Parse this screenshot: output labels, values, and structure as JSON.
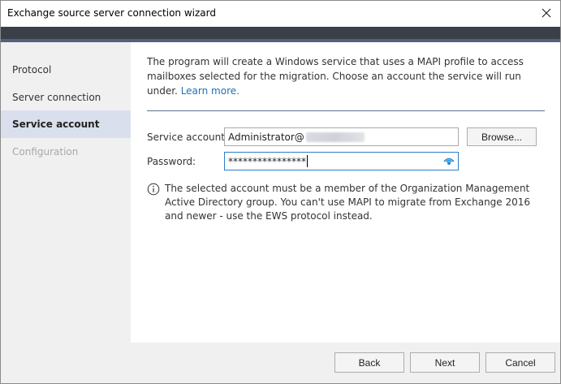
{
  "window": {
    "title": "Exchange source server connection wizard"
  },
  "sidebar": {
    "items": [
      {
        "label": "Protocol",
        "state": "normal"
      },
      {
        "label": "Server connection",
        "state": "normal"
      },
      {
        "label": "Service account",
        "state": "active"
      },
      {
        "label": "Configuration",
        "state": "disabled"
      }
    ]
  },
  "main": {
    "description": "The program will create a Windows service that uses a MAPI profile to access mailboxes selected for the migration. Choose an account the service will run under.",
    "learn_more": "Learn more.",
    "service_account": {
      "label": "Service account:",
      "value": "Administrator@"
    },
    "password": {
      "label": "Password:",
      "value": "****************"
    },
    "browse_label": "Browse...",
    "info_text": "The selected account must be a member of the Organization Management Active Directory group. You can't use MAPI to migrate from Exchange 2016 and newer - use the EWS protocol instead."
  },
  "footer": {
    "back_label": "Back",
    "next_label": "Next",
    "cancel_label": "Cancel"
  },
  "colors": {
    "title_dark_bar": "#3b3f47",
    "accent_bar": "#53617e",
    "active_nav_bg": "#d9dfec",
    "link": "#2470b8",
    "eye_icon": "#1f8ad2"
  },
  "icons": {
    "close": "close-icon",
    "eye": "eye-icon",
    "info": "info-icon"
  }
}
